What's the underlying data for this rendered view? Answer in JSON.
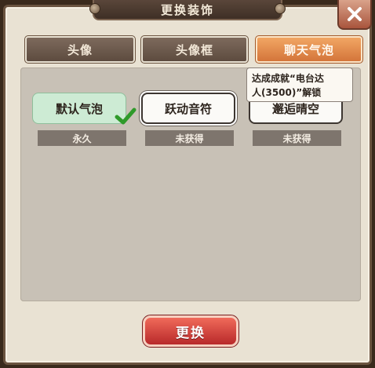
{
  "header": {
    "title": "更换装饰"
  },
  "tabs": [
    {
      "label": "头像",
      "active": false
    },
    {
      "label": "头像框",
      "active": false
    },
    {
      "label": "聊天气泡",
      "active": true
    }
  ],
  "bubbles": [
    {
      "name": "默认气泡",
      "status": "永久",
      "selected": true
    },
    {
      "name": "跃动音符",
      "status": "未获得",
      "selected": false
    },
    {
      "name": "邂逅晴空",
      "status": "未获得",
      "selected": false
    }
  ],
  "tooltip": {
    "line1": "达成成就“电台达",
    "line2": "人(3500)”解锁"
  },
  "footer": {
    "confirm_label": "更换"
  },
  "icons": {
    "close": "close-icon",
    "check": "checkmark-icon"
  },
  "colors": {
    "active_tab": "#e38a4c",
    "confirm": "#d9403a",
    "selected_bubble": "#cdebd4"
  }
}
